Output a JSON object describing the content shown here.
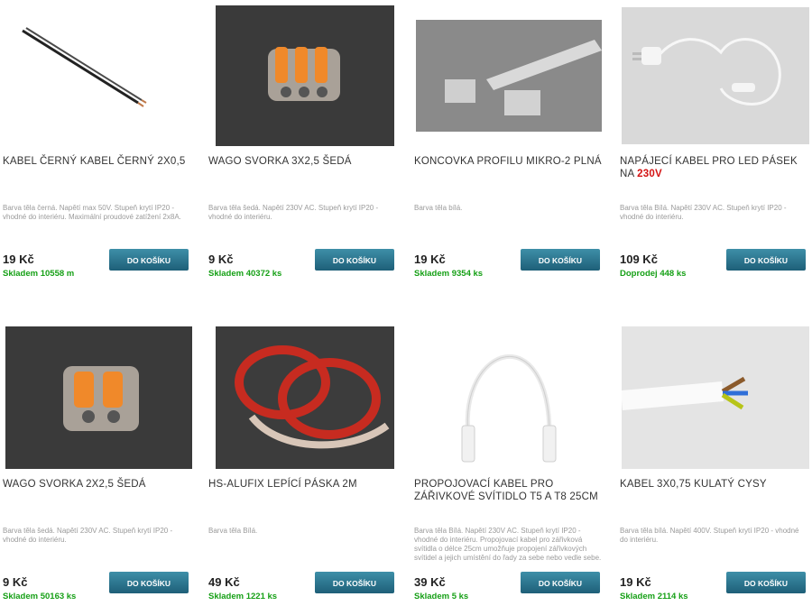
{
  "products": [
    {
      "title": "KABEL ČERNÝ KABEL ČERNÝ 2X0,5",
      "title_highlight": "",
      "desc": "Barva těla černá. Napětí max 50V. Stupeň krytí IP20 - vhodné do interiéru. Maximální proudové zatížení 2x8A.",
      "price": "19 Kč",
      "stock": "Skladem 10558 m",
      "button": "DO KOŠÍKU",
      "image_icon": "black-cable"
    },
    {
      "title": "WAGO SVORKA 3X2,5 ŠEDÁ",
      "title_highlight": "",
      "desc": "Barva těla šedá. Napětí 230V AC. Stupeň krytí IP20 - vhodné do interiéru.",
      "price": "9 Kč",
      "stock": "Skladem 40372 ks",
      "button": "DO KOŠÍKU",
      "image_icon": "wago-3-clamp"
    },
    {
      "title": "KONCOVKA PROFILU MIKRO-2 PLNÁ",
      "title_highlight": "",
      "desc": "Barva těla bílá.",
      "price": "19 Kč",
      "stock": "Skladem 9354 ks",
      "button": "DO KOŠÍKU",
      "image_icon": "profile-end-cap"
    },
    {
      "title": "NAPÁJECÍ KABEL PRO LED PÁSEK NA",
      "title_highlight": "230V",
      "desc": "Barva těla Bílá. Napětí 230V AC. Stupeň krytí IP20 - vhodné do interiéru.",
      "price": "109 Kč",
      "stock": "Doprodej 448 ks",
      "button": "DO KOŠÍKU",
      "image_icon": "power-cable"
    },
    {
      "title": "WAGO SVORKA 2X2,5 ŠEDÁ",
      "title_highlight": "",
      "desc": "Barva těla šedá. Napětí 230V AC. Stupeň krytí IP20 - vhodné do interiéru.",
      "price": "9 Kč",
      "stock": "Skladem 50163 ks",
      "button": "DO KOŠÍKU",
      "image_icon": "wago-2-clamp"
    },
    {
      "title": "HS-ALUFIX LEPÍCÍ PÁSKA 2M",
      "title_highlight": "",
      "desc": "Barva těla Bílá.",
      "price": "49 Kč",
      "stock": "Skladem 1221 ks",
      "button": "DO KOŠÍKU",
      "image_icon": "tape-rolls"
    },
    {
      "title": "PROPOJOVACÍ KABEL PRO ZÁŘIVKOVÉ SVÍTIDLO T5 A T8 25CM",
      "title_highlight": "",
      "desc": "Barva těla Bílá. Napětí 230V AC. Stupeň krytí IP20 - vhodné do interiéru. Propojovací kabel pro zářivková svítidla o délce 25cm umožňuje propojení zářivkových svítidel a jejich umístění do řady za sebe nebo vedle sebe.",
      "price": "39 Kč",
      "stock": "Skladem 5 ks",
      "button": "DO KOŠÍKU",
      "image_icon": "connection-cable"
    },
    {
      "title": "KABEL 3X0,75 KULATÝ CYSY",
      "title_highlight": "",
      "desc": "Barva těla bílá. Napětí 400V. Stupeň krytí IP20 - vhodné do interiéru.",
      "price": "19 Kč",
      "stock": "Skladem 2114 ks",
      "button": "DO KOŠÍKU",
      "image_icon": "cysy-cable"
    }
  ],
  "colors": {
    "stock_green": "#16a016",
    "highlight_red": "#d41313",
    "button": "#2a7390"
  }
}
